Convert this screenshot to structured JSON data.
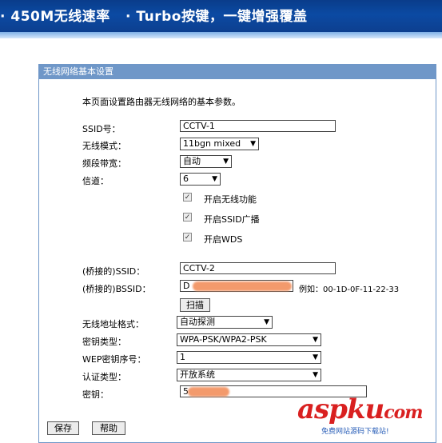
{
  "banner": {
    "text": "· 450M无线速率   · Turbo按键，一键增强覆盖"
  },
  "panel": {
    "title": "无线网络基本设置",
    "intro": "本页面设置路由器无线网络的基本参数。",
    "ssid_label": "SSID号：",
    "ssid_value": "CCTV-1",
    "mode_label": "无线模式：",
    "mode_value": "11bgn mixed",
    "bandwidth_label": "频段带宽：",
    "bandwidth_value": "自动",
    "channel_label": "信道：",
    "channel_value": "6",
    "enable_wireless_label": "开启无线功能",
    "enable_ssid_broadcast_label": "开启SSID广播",
    "enable_wds_label": "开启WDS",
    "bridge_ssid_label": "(桥接的)SSID：",
    "bridge_ssid_value": "CCTV-2",
    "bridge_bssid_label": "(桥接的)BSSID：",
    "bridge_bssid_value": "D",
    "bssid_example": "例如：00-1D-0F-11-22-33",
    "scan_button": "扫描",
    "addr_format_label": "无线地址格式：",
    "addr_format_value": "自动探测",
    "key_type_label": "密钥类型：",
    "key_type_value": "WPA-PSK/WPA2-PSK",
    "wep_index_label": "WEP密钥序号：",
    "wep_index_value": "1",
    "auth_type_label": "认证类型：",
    "auth_type_value": "开放系统",
    "key_label": "密钥：",
    "key_value": "5",
    "save_button": "保存",
    "help_button": "帮助"
  },
  "watermark": {
    "text": "aspku",
    "suffix": "com",
    "sub": "免费网站源码下载站!"
  },
  "colors": {
    "panel_title_bg": "#6f97c8",
    "banner_bg": "#0b4aa3",
    "blur": "#f39a6c",
    "watermark": "#d92020"
  }
}
